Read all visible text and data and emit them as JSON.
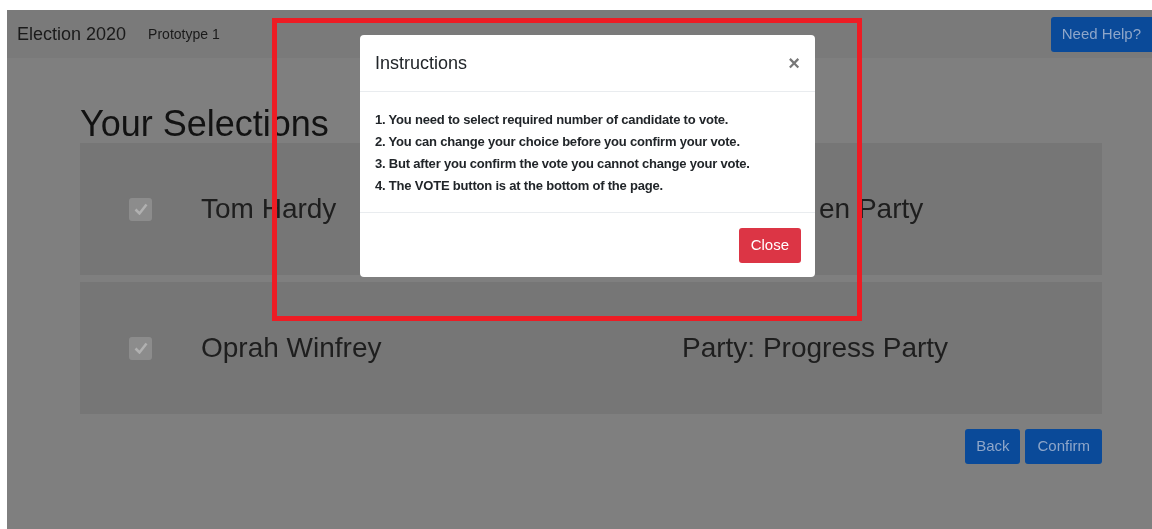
{
  "navbar": {
    "brand": "Election 2020",
    "subtitle": "Prototype 1",
    "help_button": "Need Help?"
  },
  "heading": "Your Selections",
  "selections": [
    {
      "name": "Tom Hardy",
      "checked": true,
      "party": "en Party",
      "partly_hidden": true
    },
    {
      "name": "Oprah Winfrey",
      "checked": true,
      "party": "Party: Progress Party",
      "partly_hidden": false
    }
  ],
  "buttons": [
    "Back",
    "Confirm"
  ],
  "dialog": {
    "title": "Instructions",
    "close_icon": "×",
    "lines": [
      "1. You need to select required number of candidate to vote.",
      "2. You can change your choice before you confirm your vote.",
      "3. But after you confirm the vote you cannot change your vote.",
      "4. The VOTE button is at the bottom of the page."
    ],
    "close_button": "Close"
  }
}
